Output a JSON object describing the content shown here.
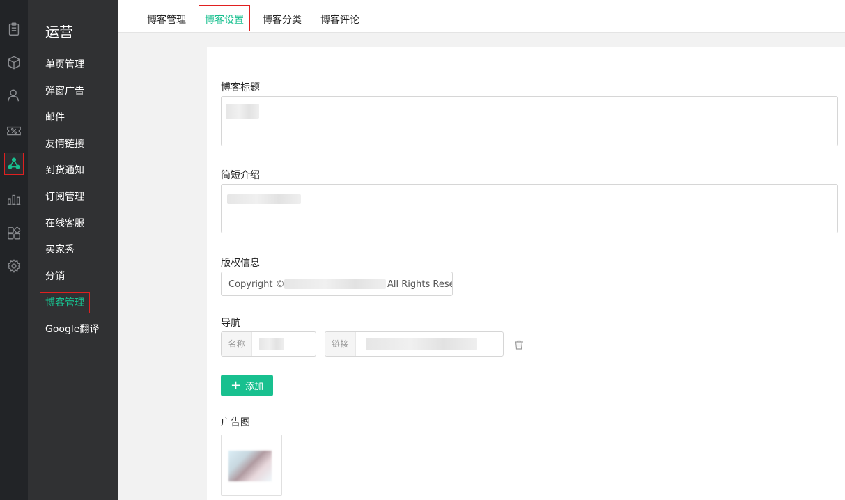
{
  "rail": {
    "icons": [
      "clipboard-icon",
      "box-icon",
      "user-icon",
      "coupon-icon",
      "share-icon",
      "chart-icon",
      "apps-icon",
      "gear-icon"
    ],
    "active_color": "#18c08f"
  },
  "submenu": {
    "title": "运营",
    "items": [
      "单页管理",
      "弹窗广告",
      "邮件",
      "友情链接",
      "到货通知",
      "订阅管理",
      "在线客服",
      "买家秀",
      "分销",
      "博客管理",
      "Google翻译"
    ],
    "active_index": 9
  },
  "tabs": [
    "博客管理",
    "博客设置",
    "博客分类",
    "博客评论"
  ],
  "active_tab": 1,
  "form": {
    "blog_title_label": "博客标题",
    "intro_label": "简短介绍",
    "copyright_label": "版权信息",
    "copyright_prefix": "Copyright ©",
    "copyright_suffix": "All Rights Rese",
    "nav_label": "导航",
    "nav_name_prefix": "名称",
    "nav_link_prefix": "链接",
    "add_button": "添加",
    "ad_image_label": "广告图"
  },
  "colors": {
    "accent": "#18c08f",
    "highlight_border": "#e02020"
  }
}
